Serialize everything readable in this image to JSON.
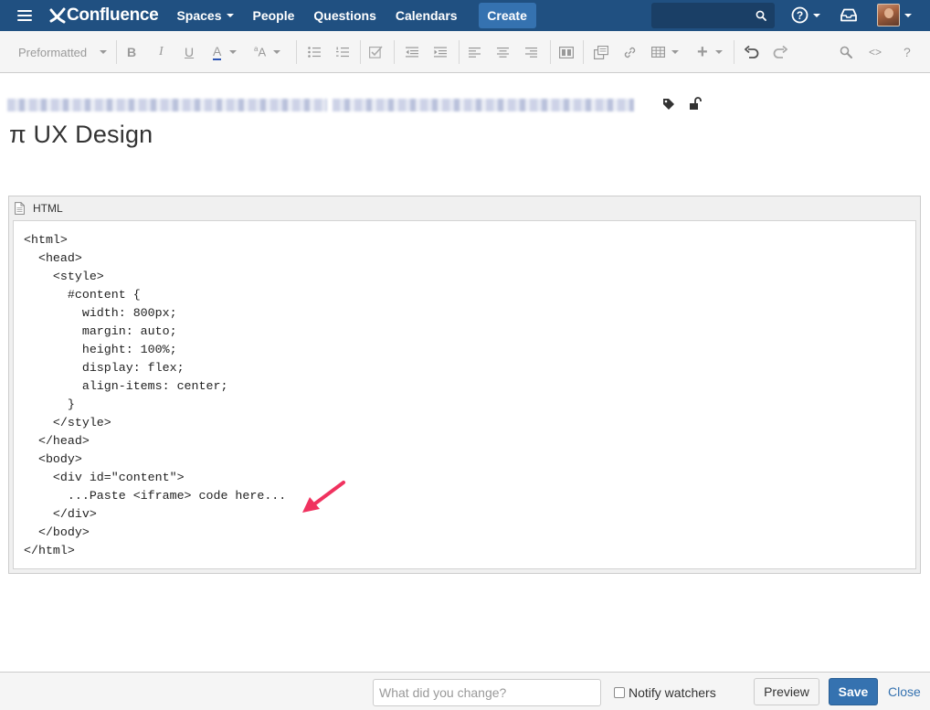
{
  "nav": {
    "logo_text": "Confluence",
    "items": [
      {
        "label": "Spaces",
        "dropdown": true
      },
      {
        "label": "People",
        "dropdown": false
      },
      {
        "label": "Questions",
        "dropdown": false
      },
      {
        "label": "Calendars",
        "dropdown": false
      }
    ],
    "create_label": "Create",
    "search_placeholder": "",
    "icons": [
      "menu-icon",
      "search-icon",
      "help-icon",
      "inbox-icon",
      "avatar"
    ]
  },
  "toolbar": {
    "paragraph_style": "Preformatted",
    "icons": [
      "bold-icon",
      "italic-icon",
      "underline-icon",
      "text-color-icon",
      "text-format-icon",
      "bullet-list-icon",
      "numbered-list-icon",
      "task-list-icon",
      "outdent-icon",
      "indent-icon",
      "align-left-icon",
      "align-center-icon",
      "align-right-icon",
      "page-layout-icon",
      "insert-file-icon",
      "link-icon",
      "table-icon",
      "insert-more-icon",
      "undo-icon",
      "redo-icon",
      "find-replace-icon",
      "source-editor-icon",
      "help-icon"
    ],
    "source_editor_label": "<>",
    "help_label": "?"
  },
  "page": {
    "title": "π UX Design"
  },
  "macro": {
    "name": "HTML",
    "code_lines": [
      "<html>",
      "  <head>",
      "    <style>",
      "      #content {",
      "        width: 800px;",
      "        margin: auto;",
      "        height: 100%;",
      "        display: flex;",
      "        align-items: center;",
      "      }",
      "    </style>",
      "  </head>",
      "  <body>",
      "    <div id=\"content\">",
      "      ...Paste <iframe> code here...",
      "    </div>",
      "  </body>",
      "</html>"
    ]
  },
  "footer": {
    "change_placeholder": "What did you change?",
    "notify_label": "Notify watchers",
    "preview_label": "Preview",
    "save_label": "Save",
    "close_label": "Close"
  },
  "colors": {
    "nav_bg": "#205081",
    "primary": "#3572b0",
    "annotation_arrow": "#f0325f"
  }
}
